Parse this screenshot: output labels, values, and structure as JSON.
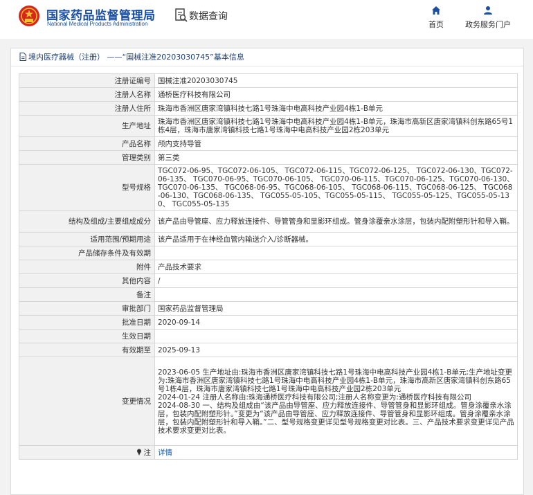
{
  "header": {
    "brand_cn": "国家药品监督管理局",
    "brand_en": "National Medical Products Administration",
    "data_query": "数据查询",
    "nav": [
      {
        "label": "首页",
        "icon": "home-icon"
      },
      {
        "label": "政务服务门户",
        "icon": "user-icon"
      }
    ]
  },
  "breadcrumb": {
    "text": "境内医疗器械（注册） ——“国械注准20203030745”基本信息"
  },
  "records": [
    {
      "label": "注册证编号",
      "value": "国械注准20203030745"
    },
    {
      "label": "注册人名称",
      "value": "通桥医疗科技有限公司"
    },
    {
      "label": "注册人住所",
      "value": "珠海市香洲区唐家湾镇科技七路1号珠海中电高科技产业园4栋1-B单元"
    },
    {
      "label": "生产地址",
      "value": "珠海市香洲区唐家湾镇科技七路1号珠海中电高科技产业园4栋1-B单元，珠海市高新区唐家湾镇科创东路65号1栋4层，珠海市唐家湾镇科技七路1号珠海中电高科技产业园2栋203单元"
    },
    {
      "label": "产品名称",
      "value": "颅内支持导管"
    },
    {
      "label": "管理类别",
      "value": "第三类"
    },
    {
      "label": "型号规格",
      "value": "TGC072-06-95、TGC072-06-105、 TGC072-06-115、TGC072-06-125、 TGC072-06-130、TGC072-06-135、 TGC070-06-95、TGC070-06-105、 TGC070-06-115、TGC070-06-125、TGC070-06-130、TGC070-06-135、 TGC068-06-95、TGC068-06-105、 TGC068-06-115、TGC068-06-125、 TGC068-06-130、TGC068-06-135、 TGC055-05-105、TGC055-05-115、 TGC055-05-125、TGC055-05-130、 TGC055-05-135"
    },
    {
      "label": "结构及组成/主要组成成分",
      "value": "该产品由导管座、应力释放连接件、导管管身和显影环组成。管身涂覆亲水涂层，包装内配附塑形针和导入鞘。"
    },
    {
      "label": "适用范围/预期用途",
      "value": "该产品适用于在神经血管内输送介入/诊断器械。"
    },
    {
      "label": "产品储存条件及有效期",
      "value": ""
    },
    {
      "label": "附件",
      "value": "产品技术要求"
    },
    {
      "label": "其他内容",
      "value": "/"
    },
    {
      "label": "备注",
      "value": ""
    },
    {
      "label": "审批部门",
      "value": "国家药品监督管理局"
    },
    {
      "label": "批准日期",
      "value": "2020-09-14"
    },
    {
      "label": "生效日期",
      "value": ""
    },
    {
      "label": "有效期至",
      "value": "2025-09-13"
    },
    {
      "label": "变更情况",
      "value": "2023-06-05 生产地址由:珠海市香洲区唐家湾镇科技七路1号珠海中电高科技产业园4栋1-B单元;生产地址变更为:珠海市香洲区唐家湾镇科技七路1号珠海中电高科技产业园4栋1-B单元，珠海市高新区唐家湾镇科创东路65号1栋4层，珠海市唐家湾镇科技七路1号珠海中电高科技产业园2栋203单元\n2024-01-24 注册人名称由:珠海通桥医疗科技有限公司;注册人名称变更为:通桥医疗科技有限公司\n2024-08-30 一、结构及组成由“该产品由导管座、应力释放连接件、导管管身和显影环组成。管身涂覆亲水涂层，包装内配附塑形针。”变更为“该产品由导管座、应力释放连接件、导管管身和显影环组成。管身涂覆亲水涂层，包装内配附塑形针和导入鞘。”二、型号规格变更详见型号规格变更对比表。三、产品技术要求变更详见产品技术要求变更对比表。"
    }
  ],
  "note_row": {
    "label": "注",
    "link": "详情"
  }
}
